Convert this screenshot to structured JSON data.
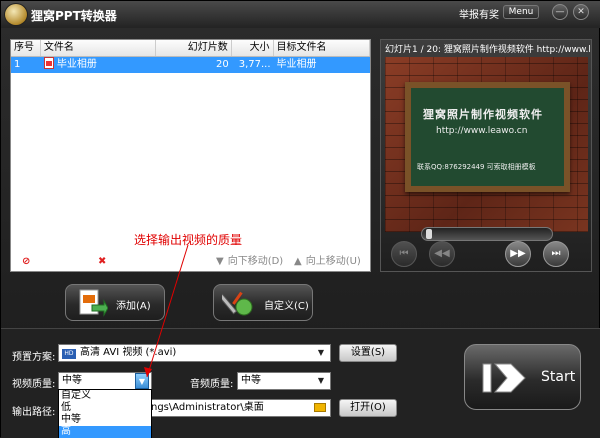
{
  "app": {
    "title": "狸窝PPT转换器",
    "report": "举报有奖",
    "menu": "Menu",
    "minimize": "—",
    "close": "✕"
  },
  "list": {
    "columns": [
      "序号",
      "文件名",
      "幻灯片数",
      "大小",
      "目标文件名"
    ],
    "rows": [
      {
        "index": "1",
        "filename": "毕业相册",
        "slides": "20",
        "size": "3,77...",
        "target": "毕业相册"
      }
    ]
  },
  "list_tools": {
    "remove": "移除(R)",
    "clear": "清除(C)",
    "move_down": "向下移动(D)",
    "move_up": "向上移动(U)"
  },
  "preview": {
    "caption": "幻灯片1 / 20: 狸窝照片制作视频软件 http://www.leawo.cn",
    "board_line1": "狸窝照片制作视频软件",
    "board_line2": "http://www.leawo.cn",
    "board_line3": "联系QQ:876292449 可索取相册模板"
  },
  "buttons": {
    "add": "添加(A)",
    "custom": "自定义(C)",
    "start": "Start"
  },
  "settings": {
    "preset_label": "预置方案:",
    "preset_badge": "HD",
    "preset_value": "高清 AVI 视频 (*.avi)",
    "settings_btn": "设置(S)",
    "video_quality_label": "视频质量:",
    "video_quality_value": "中等",
    "audio_quality_label": "音频质量:",
    "audio_quality_value": "中等",
    "output_label": "输出路径:",
    "output_value": "ngs\\Administrator\\桌面",
    "open_btn": "打开(O)"
  },
  "quality_options": {
    "items": [
      "自定义",
      "低",
      "中等",
      "高"
    ],
    "selected": "高"
  },
  "annotation": "选择输出视频的质量",
  "colors": {
    "selection": "#3399ff",
    "annotation": "#e00000"
  }
}
